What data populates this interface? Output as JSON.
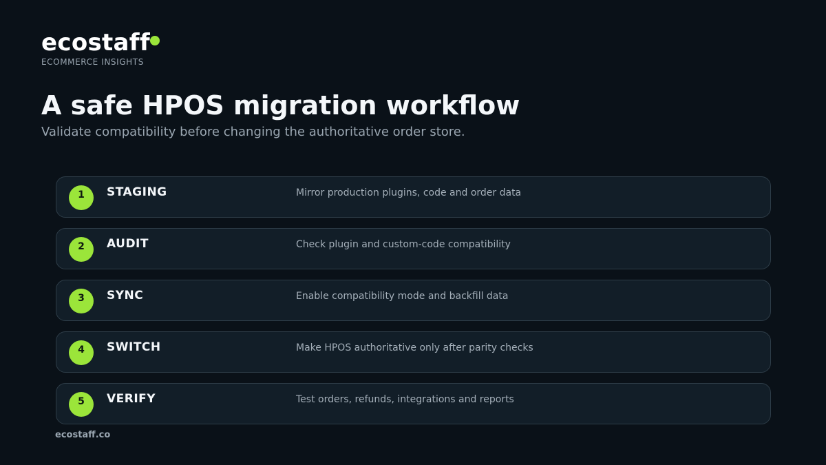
{
  "brand": {
    "name": "ecostaff",
    "tagline": "ECOMMERCE INSIGHTS",
    "accent_color": "#9be53a"
  },
  "title": "A safe HPOS migration workflow",
  "subtitle": "Validate compatibility before changing the authoritative order store.",
  "steps": [
    {
      "number": "1",
      "name": "STAGING",
      "description": "Mirror production plugins, code and order data"
    },
    {
      "number": "2",
      "name": "AUDIT",
      "description": "Check plugin and custom-code compatibility"
    },
    {
      "number": "3",
      "name": "SYNC",
      "description": "Enable compatibility mode and backfill data"
    },
    {
      "number": "4",
      "name": "SWITCH",
      "description": "Make HPOS authoritative only after parity checks"
    },
    {
      "number": "5",
      "name": "VERIFY",
      "description": "Test orders, refunds, integrations and reports"
    }
  ],
  "footer": "ecostaff.co"
}
